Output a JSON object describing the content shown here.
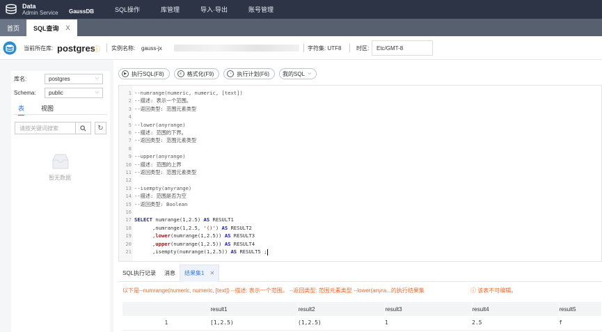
{
  "app": {
    "title_line1": "Data",
    "title_line2": "Admin Service",
    "product": "GaussDB"
  },
  "topmenu": [
    "SQL操作",
    "库管理",
    "导入·导出",
    "账号管理"
  ],
  "tabs": {
    "home": "首页",
    "sql": "SQL查询",
    "close": "X"
  },
  "info": {
    "current_db_label": "当前所在库:",
    "current_db": "postgres",
    "instance_label": "实例名称:",
    "instance_value": "gauss-jx",
    "charset": "字符集: UTF8",
    "timezone_label": "时区:",
    "timezone_value": "Etc/GMT-8"
  },
  "sidebar": {
    "db_label": "库名:",
    "db_value": "postgres",
    "schema_label": "Schema:",
    "schema_value": "public",
    "tab_table": "表",
    "tab_view": "视图",
    "search_placeholder": "请按关键词搜索",
    "empty_text": "暂无数据"
  },
  "toolbar": {
    "execute": "执行SQL(F8)",
    "format": "格式化(F9)",
    "plan": "执行计划(F6)",
    "mysql": "我的SQL"
  },
  "editor": {
    "lines": [
      "--numrange(numeric, numeric, [text])",
      "--描述: 表示一个范围。",
      "--返回类型: 范围元素类型",
      "",
      "--lower(anyrange)",
      "--描述: 范围的下界。",
      "--返回类型: 范围元素类型",
      "",
      "--upper(anyrange)",
      "--描述: 范围的上界",
      "--返回类型: 范围元素类型",
      "",
      "--isempty(anyrange)",
      "--描述: 范围是否为空",
      "--返回类型: Boolean",
      "",
      "SELECT numrange(1,2.5) AS RESULT1",
      "      ,numrange(1,2.5, '()') AS RESULT2",
      "      ,lower(numrange(1,2.5)) AS RESULT3",
      "      ,upper(numrange(1,2.5)) AS RESULT4",
      "      ,isempty(numrange(1,2.5)) AS RESULT5 ;"
    ]
  },
  "bottom": {
    "tab_history": "SQL执行记录",
    "tab_message": "消息",
    "tab_result": "结果集1",
    "message": "以下是--numrange(numeric, numeric, [text]) --描述: 表示一个范围。 --返回类型: 范围元素类型 --lower(anyra...的执行结果集",
    "readonly": "该表不可编辑。",
    "columns": [
      "",
      "result1",
      "result2",
      "result3",
      "result4",
      "result5"
    ],
    "rows": [
      [
        "1",
        "[1,2.5)",
        "(1,2.5)",
        "1",
        "2.5",
        "f"
      ]
    ]
  }
}
